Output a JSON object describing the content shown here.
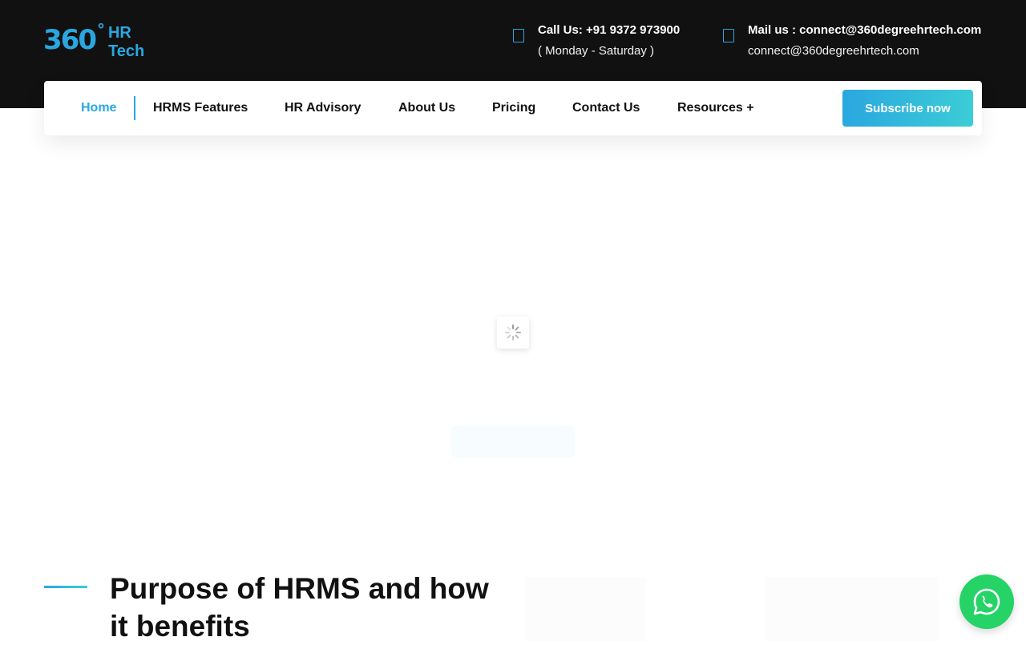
{
  "logo": {
    "mark": "360",
    "degree": "°",
    "text": "HR Tech"
  },
  "contact": {
    "phone": {
      "icon": "phone-icon",
      "line1": "Call Us: +91 9372 973900",
      "line2": "( Monday - Saturday )"
    },
    "mail": {
      "icon": "mail-icon",
      "line1": "Mail us : connect@360degreehrtech.com",
      "line2": "connect@360degreehrtech.com"
    }
  },
  "nav": {
    "items": [
      {
        "label": "Home",
        "active": true
      },
      {
        "label": "HRMS Features"
      },
      {
        "label": "HR Advisory"
      },
      {
        "label": "About Us"
      },
      {
        "label": "Pricing"
      },
      {
        "label": "Contact Us"
      },
      {
        "label": "Resources +"
      }
    ],
    "cta": "Subscribe now"
  },
  "section": {
    "title": "Purpose of HRMS and how it benefits"
  },
  "colors": {
    "accent": "#2aa7e0",
    "accent2": "#3bcdd6",
    "topbar": "#111111",
    "whatsapp": "#25d366"
  }
}
